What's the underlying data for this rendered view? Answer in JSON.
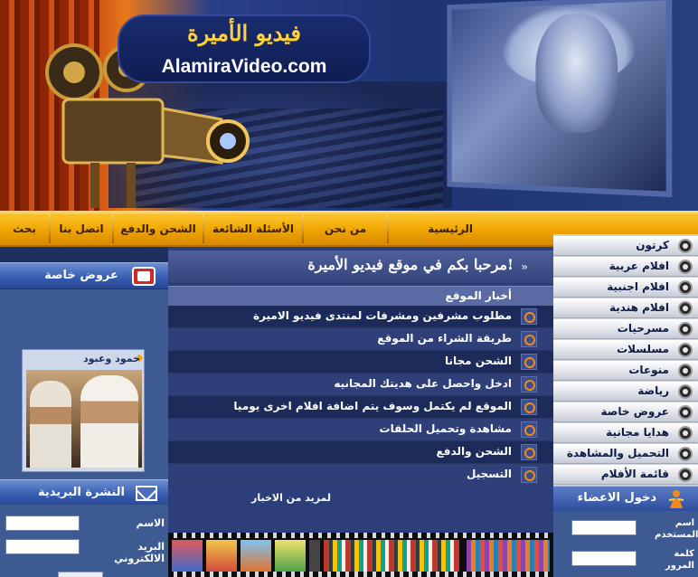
{
  "site": {
    "logo_arabic": "فيديو الأميرة",
    "logo_english": "AlamiraVideo.com"
  },
  "nav": {
    "items": [
      {
        "label": "الرئيسية"
      },
      {
        "label": "من نحن"
      },
      {
        "label": "الأسئلة الشائعة"
      },
      {
        "label": "الشحن والدفع"
      },
      {
        "label": "اتصل بنا"
      },
      {
        "label": "بحث"
      }
    ]
  },
  "left": {
    "offers_title": "عروض خاصة",
    "offer_card_title": "حمود وعبود",
    "newsletter_title": "النشرة البريدية",
    "name_label": "الاسم",
    "email_label": "البريد الالكتروني"
  },
  "center": {
    "welcome": "مرحبا بكم في موقع فيديو الأميرة!",
    "news_heading": "أخبار الموقع",
    "news": [
      "مطلوب مشرفين ومشرفات لمنتدى فيديو الاميرة",
      "طريقة الشراء من الموقع",
      "الشحن مجانا",
      "ادخل واحصل على هديتك المجانيه",
      "الموقع لم يكتمل وسوف يتم اضافة افلام اخرى يوميا",
      "مشاهدة وتحميل الحلقات",
      "الشحن والدفع",
      "التسجيل"
    ],
    "more_news": "لمزيد من الاخبار"
  },
  "right": {
    "categories": [
      "كرتون",
      "افلام عربية",
      "افلام اجنبية",
      "افلام هندية",
      "مسرحيات",
      "مسلسلات",
      "منوعات",
      "رياضة",
      "عروض خاصة",
      "هدايا مجانية",
      "التحميل والمشاهدة",
      "قائمة الأفلام"
    ],
    "members_title": "دخول الاعضاء",
    "username_label": "اسم المستخدم",
    "password_label": "كلمة المرور"
  },
  "colors": {
    "nav_gold": "#f0a500",
    "panel_blue": "#3d5a93",
    "content_navy": "#2c3f7a",
    "accent_orange": "#f08a1c"
  }
}
